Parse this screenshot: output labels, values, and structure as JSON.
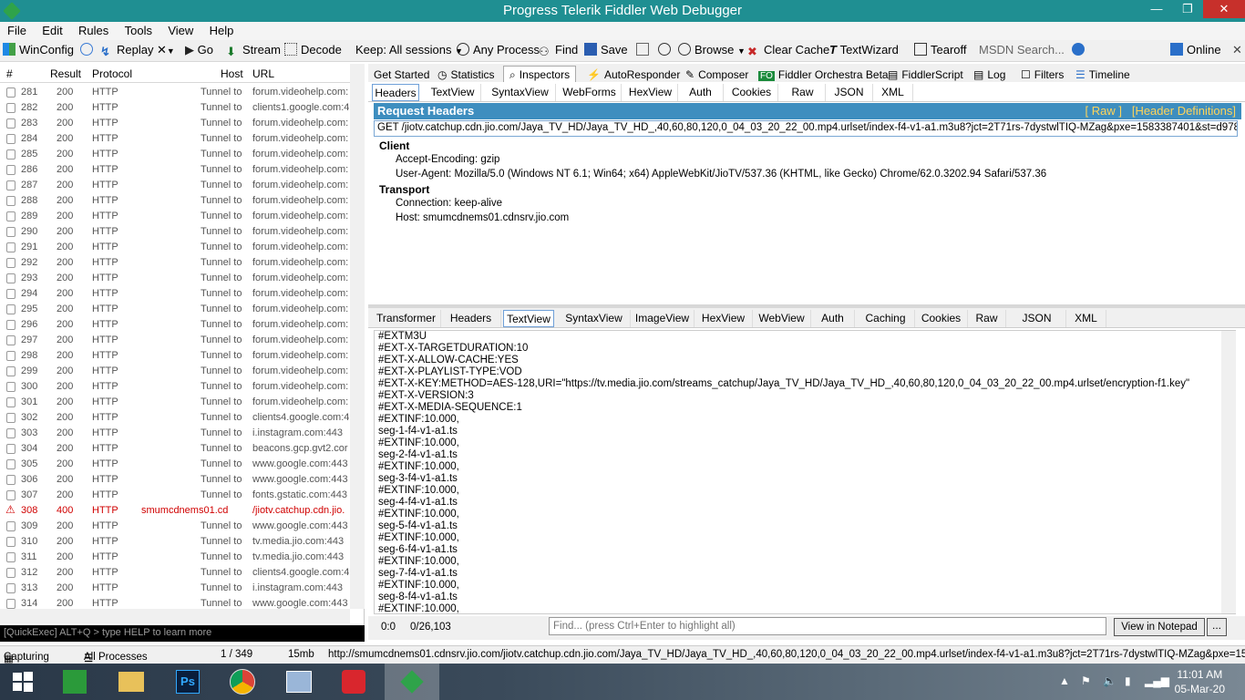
{
  "window": {
    "title": "Progress Telerik Fiddler Web Debugger",
    "min": "—",
    "max": "❐",
    "close": "✕"
  },
  "menu": [
    "File",
    "Edit",
    "Rules",
    "Tools",
    "View",
    "Help"
  ],
  "toolbar": {
    "winconfig": "WinConfig",
    "replay": "Replay",
    "remove": "✕",
    "go": "Go",
    "stream": "Stream",
    "decode": "Decode",
    "keep": "Keep: All sessions",
    "any_process": "Any Process",
    "find": "Find",
    "save": "Save",
    "browse": "Browse",
    "clear_cache": "Clear Cache",
    "textwizard": "TextWizard",
    "tearoff": "Tearoff",
    "msdn": "MSDN Search...",
    "online": "Online"
  },
  "sessions": {
    "headers": {
      "num": "#",
      "result": "Result",
      "protocol": "Protocol",
      "host": "Host",
      "url": "URL"
    },
    "rows": [
      {
        "id": "281",
        "result": "200",
        "protocol": "HTTP",
        "host": "Tunnel to",
        "url": "forum.videohelp.com:"
      },
      {
        "id": "282",
        "result": "200",
        "protocol": "HTTP",
        "host": "Tunnel to",
        "url": "clients1.google.com:4"
      },
      {
        "id": "283",
        "result": "200",
        "protocol": "HTTP",
        "host": "Tunnel to",
        "url": "forum.videohelp.com:"
      },
      {
        "id": "284",
        "result": "200",
        "protocol": "HTTP",
        "host": "Tunnel to",
        "url": "forum.videohelp.com:"
      },
      {
        "id": "285",
        "result": "200",
        "protocol": "HTTP",
        "host": "Tunnel to",
        "url": "forum.videohelp.com:"
      },
      {
        "id": "286",
        "result": "200",
        "protocol": "HTTP",
        "host": "Tunnel to",
        "url": "forum.videohelp.com:"
      },
      {
        "id": "287",
        "result": "200",
        "protocol": "HTTP",
        "host": "Tunnel to",
        "url": "forum.videohelp.com:"
      },
      {
        "id": "288",
        "result": "200",
        "protocol": "HTTP",
        "host": "Tunnel to",
        "url": "forum.videohelp.com:"
      },
      {
        "id": "289",
        "result": "200",
        "protocol": "HTTP",
        "host": "Tunnel to",
        "url": "forum.videohelp.com:"
      },
      {
        "id": "290",
        "result": "200",
        "protocol": "HTTP",
        "host": "Tunnel to",
        "url": "forum.videohelp.com:"
      },
      {
        "id": "291",
        "result": "200",
        "protocol": "HTTP",
        "host": "Tunnel to",
        "url": "forum.videohelp.com:"
      },
      {
        "id": "292",
        "result": "200",
        "protocol": "HTTP",
        "host": "Tunnel to",
        "url": "forum.videohelp.com:"
      },
      {
        "id": "293",
        "result": "200",
        "protocol": "HTTP",
        "host": "Tunnel to",
        "url": "forum.videohelp.com:"
      },
      {
        "id": "294",
        "result": "200",
        "protocol": "HTTP",
        "host": "Tunnel to",
        "url": "forum.videohelp.com:"
      },
      {
        "id": "295",
        "result": "200",
        "protocol": "HTTP",
        "host": "Tunnel to",
        "url": "forum.videohelp.com:"
      },
      {
        "id": "296",
        "result": "200",
        "protocol": "HTTP",
        "host": "Tunnel to",
        "url": "forum.videohelp.com:"
      },
      {
        "id": "297",
        "result": "200",
        "protocol": "HTTP",
        "host": "Tunnel to",
        "url": "forum.videohelp.com:"
      },
      {
        "id": "298",
        "result": "200",
        "protocol": "HTTP",
        "host": "Tunnel to",
        "url": "forum.videohelp.com:"
      },
      {
        "id": "299",
        "result": "200",
        "protocol": "HTTP",
        "host": "Tunnel to",
        "url": "forum.videohelp.com:"
      },
      {
        "id": "300",
        "result": "200",
        "protocol": "HTTP",
        "host": "Tunnel to",
        "url": "forum.videohelp.com:"
      },
      {
        "id": "301",
        "result": "200",
        "protocol": "HTTP",
        "host": "Tunnel to",
        "url": "forum.videohelp.com:"
      },
      {
        "id": "302",
        "result": "200",
        "protocol": "HTTP",
        "host": "Tunnel to",
        "url": "clients4.google.com:4"
      },
      {
        "id": "303",
        "result": "200",
        "protocol": "HTTP",
        "host": "Tunnel to",
        "url": "i.instagram.com:443"
      },
      {
        "id": "304",
        "result": "200",
        "protocol": "HTTP",
        "host": "Tunnel to",
        "url": "beacons.gcp.gvt2.cor"
      },
      {
        "id": "305",
        "result": "200",
        "protocol": "HTTP",
        "host": "Tunnel to",
        "url": "www.google.com:443"
      },
      {
        "id": "306",
        "result": "200",
        "protocol": "HTTP",
        "host": "Tunnel to",
        "url": "www.google.com:443"
      },
      {
        "id": "307",
        "result": "200",
        "protocol": "HTTP",
        "host": "Tunnel to",
        "url": "fonts.gstatic.com:443"
      },
      {
        "id": "308",
        "result": "400",
        "protocol": "HTTP",
        "host": "smumcdnems01.cdn...",
        "url": "/jiotv.catchup.cdn.jio.",
        "error": true
      },
      {
        "id": "309",
        "result": "200",
        "protocol": "HTTP",
        "host": "Tunnel to",
        "url": "www.google.com:443"
      },
      {
        "id": "310",
        "result": "200",
        "protocol": "HTTP",
        "host": "Tunnel to",
        "url": "tv.media.jio.com:443"
      },
      {
        "id": "311",
        "result": "200",
        "protocol": "HTTP",
        "host": "Tunnel to",
        "url": "tv.media.jio.com:443"
      },
      {
        "id": "312",
        "result": "200",
        "protocol": "HTTP",
        "host": "Tunnel to",
        "url": "clients4.google.com:4"
      },
      {
        "id": "313",
        "result": "200",
        "protocol": "HTTP",
        "host": "Tunnel to",
        "url": "i.instagram.com:443"
      },
      {
        "id": "314",
        "result": "200",
        "protocol": "HTTP",
        "host": "Tunnel to",
        "url": "www.google.com:443"
      }
    ]
  },
  "quickexec": "[QuickExec] ALT+Q > type HELP to learn more",
  "main_tabs": [
    "Get Started",
    "Statistics",
    "Inspectors",
    "AutoResponder",
    "Composer",
    "Fiddler Orchestra Beta",
    "FiddlerScript",
    "Log",
    "Filters",
    "Timeline"
  ],
  "request_tabs": [
    "Headers",
    "TextView",
    "SyntaxView",
    "WebForms",
    "HexView",
    "Auth",
    "Cookies",
    "Raw",
    "JSON",
    "XML"
  ],
  "request": {
    "title": "Request Headers",
    "raw_link": "[ Raw ]",
    "defs_link": "[Header Definitions]",
    "line": "GET /jiotv.catchup.cdn.jio.com/Jaya_TV_HD/Jaya_TV_HD_,40,60,80,120,0_04_03_20_22_00.mp4.urlset/index-f4-v1-a1.m3u8?jct=2T71rs-7dystwlTIQ-MZag&pxe=1583387401&st=d978390656875(",
    "client_label": "Client",
    "accept_encoding": "Accept-Encoding: gzip",
    "user_agent": "User-Agent: Mozilla/5.0 (Windows NT 6.1; Win64; x64) AppleWebKit/JioTV/537.36 (KHTML, like Gecko) Chrome/62.0.3202.94 Safari/537.36",
    "transport_label": "Transport",
    "connection": "Connection: keep-alive",
    "host": "Host: smumcdnems01.cdnsrv.jio.com"
  },
  "response_tabs": [
    "Transformer",
    "Headers",
    "TextView",
    "SyntaxView",
    "ImageView",
    "HexView",
    "WebView",
    "Auth",
    "Caching",
    "Cookies",
    "Raw",
    "JSON",
    "XML"
  ],
  "response_lines": [
    "#EXTM3U",
    "#EXT-X-TARGETDURATION:10",
    "#EXT-X-ALLOW-CACHE:YES",
    "#EXT-X-PLAYLIST-TYPE:VOD",
    "#EXT-X-KEY:METHOD=AES-128,URI=\"https://tv.media.jio.com/streams_catchup/Jaya_TV_HD/Jaya_TV_HD_,40,60,80,120,0_04_03_20_22_00.mp4.urlset/encryption-f1.key\"",
    "#EXT-X-VERSION:3",
    "#EXT-X-MEDIA-SEQUENCE:1",
    "#EXTINF:10.000,",
    "seg-1-f4-v1-a1.ts",
    "#EXTINF:10.000,",
    "seg-2-f4-v1-a1.ts",
    "#EXTINF:10.000,",
    "seg-3-f4-v1-a1.ts",
    "#EXTINF:10.000,",
    "seg-4-f4-v1-a1.ts",
    "#EXTINF:10.000,",
    "seg-5-f4-v1-a1.ts",
    "#EXTINF:10.000,",
    "seg-6-f4-v1-a1.ts",
    "#EXTINF:10.000,",
    "seg-7-f4-v1-a1.ts",
    "#EXTINF:10.000,",
    "seg-8-f4-v1-a1.ts",
    "#EXTINF:10.000,"
  ],
  "bottom": {
    "pos": "0:0",
    "count": "0/26,103",
    "find_placeholder": "Find... (press Ctrl+Enter to highlight all)",
    "notepad": "View in Notepad",
    "more": "..."
  },
  "status": {
    "capturing": "Capturing",
    "processes": "All Processes",
    "count": "1 / 349",
    "size": "15mb",
    "url": "http://smumcdnems01.cdnsrv.jio.com/jiotv.catchup.cdn.jio.com/Jaya_TV_HD/Jaya_TV_HD_,40,60,80,120,0_04_03_20_22_00.mp4.urlset/index-f4-v1-a1.m3u8?jct=2T71rs-7dystwlTIQ-MZag&pxe=1583"
  },
  "clock": {
    "time": "11:01 AM",
    "date": "05-Mar-20"
  },
  "colors": {
    "titlebar": "#1f8f92",
    "header_bar": "#3e8ebf",
    "error": "#d00000",
    "link": "#ffd45a"
  }
}
